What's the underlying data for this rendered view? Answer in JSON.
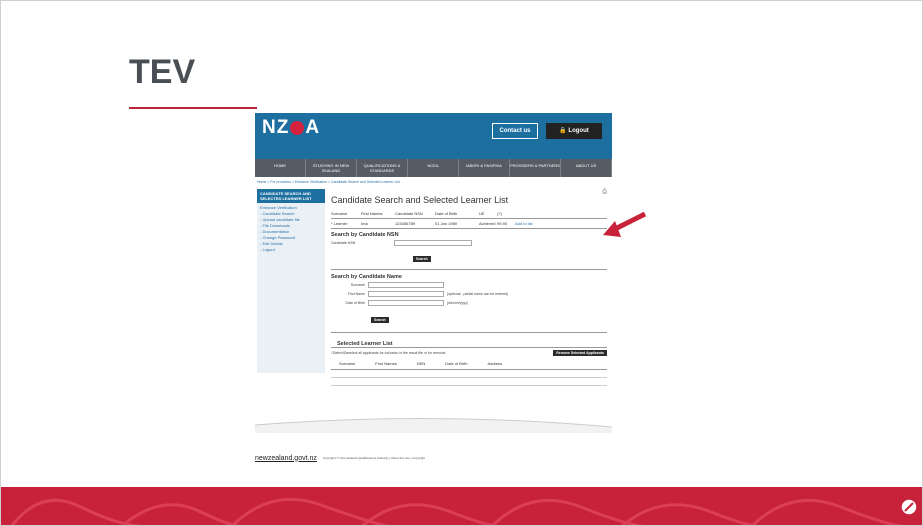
{
  "slide": {
    "title": "TEV"
  },
  "header": {
    "logo": "NZQA",
    "contact": "Contact us",
    "logout": "Logout",
    "nav": [
      "HOME",
      "STUDYING IN NEW ZEALAND",
      "QUALIFICATIONS & STANDARDS",
      "NCEA",
      "MĀORI & PASIFIKA",
      "PROVIDERS & PARTNERS",
      "ABOUT US"
    ]
  },
  "breadcrumb": "Home > For providers > Entrance Verification > Candidate Search and Selected Learner List",
  "sidebar": {
    "heading": "CANDIDATE SEARCH AND SELECTED LEARNER LIST",
    "items": [
      "Entrance Verification",
      "- Candidate Search",
      "- Upload candidate file",
      "- File Downloads",
      "- Documentation",
      "- Change Password",
      "- Edit Details",
      "- Logout"
    ]
  },
  "main": {
    "title": "Candidate Search and Selected Learner List",
    "table_headers": [
      "Surname",
      "First Names",
      "Candidate NSN",
      "Date of Birth",
      "UE",
      "(?)"
    ],
    "learner": {
      "surname": "* Learner",
      "first": "Ima",
      "nsn": "123456789",
      "dob": "01 Jan 1989",
      "ue": "Achieved",
      "score": "99.90",
      "action": "Add to list"
    },
    "nsn_search": {
      "title": "Search by Candidate NSN",
      "label": "Candidate NSN",
      "button": "Search"
    },
    "name_search": {
      "title": "Search by Candidate Name",
      "surname": "Surname",
      "first": "First Name",
      "first_hint": "(optional - partial name can be entered)",
      "dob": "Date of Birth",
      "dob_hint": "(dd/mm/yyyy)",
      "button": "Search"
    },
    "selected": {
      "title": "Selected Learner List",
      "select_all": "Select/Deselect all applicants for inclusion in the result file or for removal",
      "remove": "Remove Selected Applicants",
      "headers": [
        "Surname",
        "First Names",
        "NSN",
        "Date of Birth",
        "Address"
      ]
    }
  },
  "footer": {
    "govt": "newzealand.govt.nz",
    "copy": "Copyright © New Zealand Qualifications Authority | About this site | Copyright"
  },
  "colors": {
    "accent": "#c8223b",
    "nzqa_blue": "#1d6fa0"
  }
}
